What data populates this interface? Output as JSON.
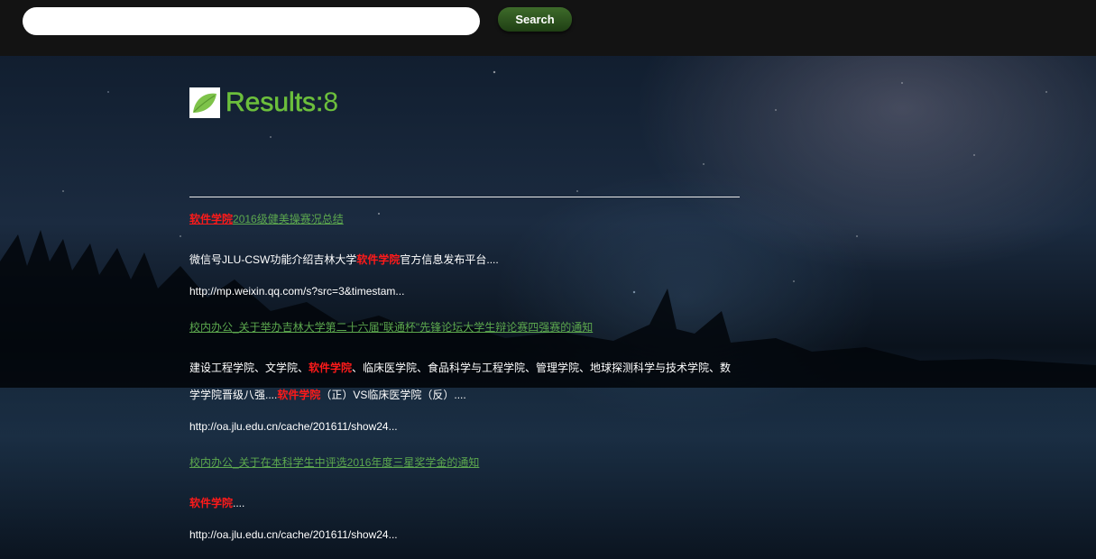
{
  "search": {
    "value": "",
    "placeholder": "",
    "button_label": "Search"
  },
  "results": {
    "label": "Results:",
    "count": "8",
    "items": [
      {
        "title_highlight": "软件学院",
        "title_rest": "2016级健美操赛况总结",
        "snippet_part1": "微信号JLU-CSW功能介绍吉林大学",
        "snippet_highlight": "软件学院",
        "snippet_part2": "官方信息发布平台....",
        "url": "http://mp.weixin.qq.com/s?src=3&timestam..."
      },
      {
        "title": "校内办公_关于举办吉林大学第二十六届\"联通杯\"先锋论坛大学生辩论赛四强赛的通知",
        "snippet_part1": "建设工程学院、文学院、",
        "snippet_highlight1": "软件学院",
        "snippet_part2": "、临床医学院、食品科学与工程学院、管理学院、地球探测科学与技术学院、数学学院晋级八强....",
        "snippet_highlight2": "软件学院",
        "snippet_part3": "（正）VS临床医学院（反）....",
        "url": "http://oa.jlu.edu.cn/cache/201611/show24..."
      },
      {
        "title": "校内办公_关于在本科学生中评选2016年度三星奖学金的通知",
        "snippet_highlight": "软件学院",
        "snippet_rest": "....",
        "url": "http://oa.jlu.edu.cn/cache/201611/show24..."
      }
    ]
  },
  "colors": {
    "accent_green": "#6cbf3c",
    "link_green": "#5ca84e",
    "highlight_red": "#ff1a1a",
    "topbar": "#131313"
  },
  "icons": {
    "results_icon": "leaf-icon"
  }
}
